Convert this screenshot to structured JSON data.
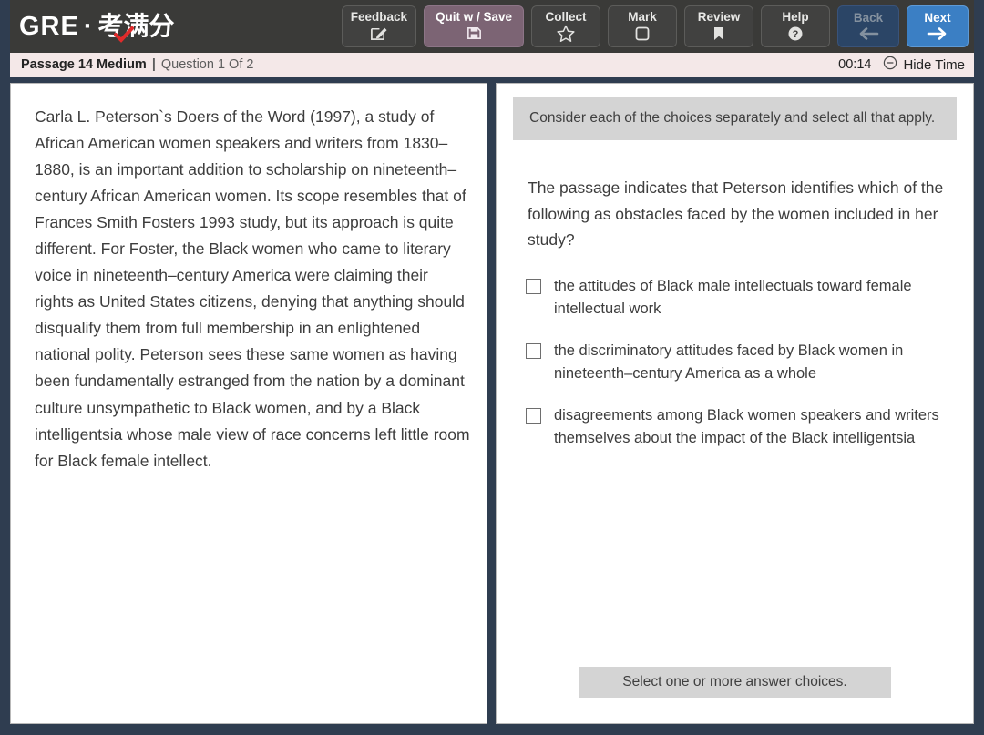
{
  "toolbar": {
    "logo_text": "GRE",
    "logo_sep": "·",
    "logo_cn": "考满分",
    "buttons": [
      {
        "label": "Feedback",
        "icon": "edit-square-icon",
        "name": "feedback-button"
      },
      {
        "label": "Quit w / Save",
        "icon": "floppy-disk-icon",
        "name": "quit-with-save-button"
      },
      {
        "label": "Collect",
        "icon": "star-icon",
        "name": "collect-button"
      },
      {
        "label": "Mark",
        "icon": "square-icon",
        "name": "mark-button"
      },
      {
        "label": "Review",
        "icon": "bookmark-icon",
        "name": "review-button"
      },
      {
        "label": "Help",
        "icon": "question-circle-icon",
        "name": "help-button"
      },
      {
        "label": "Back",
        "icon": "arrow-left-icon",
        "name": "back-button"
      },
      {
        "label": "Next",
        "icon": "arrow-right-icon",
        "name": "next-button"
      }
    ],
    "colors": {
      "bar": "#3a3a38",
      "quit_bg": "#7c6474",
      "back_bg": "#2b4566",
      "next_bg": "#3b7fc4",
      "logo_check": "#e02b2b"
    }
  },
  "statusbar": {
    "passage_label": "Passage 14 Medium",
    "separator": "|",
    "question_label": "Question 1 Of 2",
    "timer": "00:14",
    "hide_time_label": "Hide Time",
    "hide_time_icon": "circle-minus-icon",
    "background": "#f4e8e8"
  },
  "passage": {
    "text": "Carla L. Peterson`s Doers of the Word (1997), a study of African American women speakers and writers from 1830–1880, is an important addition to scholarship on nineteenth–century African American women. Its scope resembles that of Frances Smith Fosters 1993 study, but its approach is quite different. For Foster, the Black women who came to literary voice in nineteenth–century America were claiming their rights as United States citizens, denying that anything should disqualify them from full membership in an enlightened national polity. Peterson sees these same women as having been fundamentally estranged from the nation by a dominant culture unsympathetic to Black women, and by a Black intelligentsia whose male view of race concerns left little room for Black female intellect."
  },
  "question_panel": {
    "directions": "Consider each of the choices separately and select all that apply.",
    "question": "The passage indicates that Peterson identifies which of the following as obstacles faced by the women included in her study?",
    "choices": [
      {
        "text": "the attitudes of Black male intellectuals toward female intellectual work",
        "checked": false
      },
      {
        "text": "the discriminatory attitudes faced by Black women in nineteenth–century America as a whole",
        "checked": false
      },
      {
        "text": "disagreements among Black women speakers and writers themselves about the impact of the Black intelligentsia",
        "checked": false
      }
    ],
    "answer_hint": "Select one or more answer choices."
  }
}
